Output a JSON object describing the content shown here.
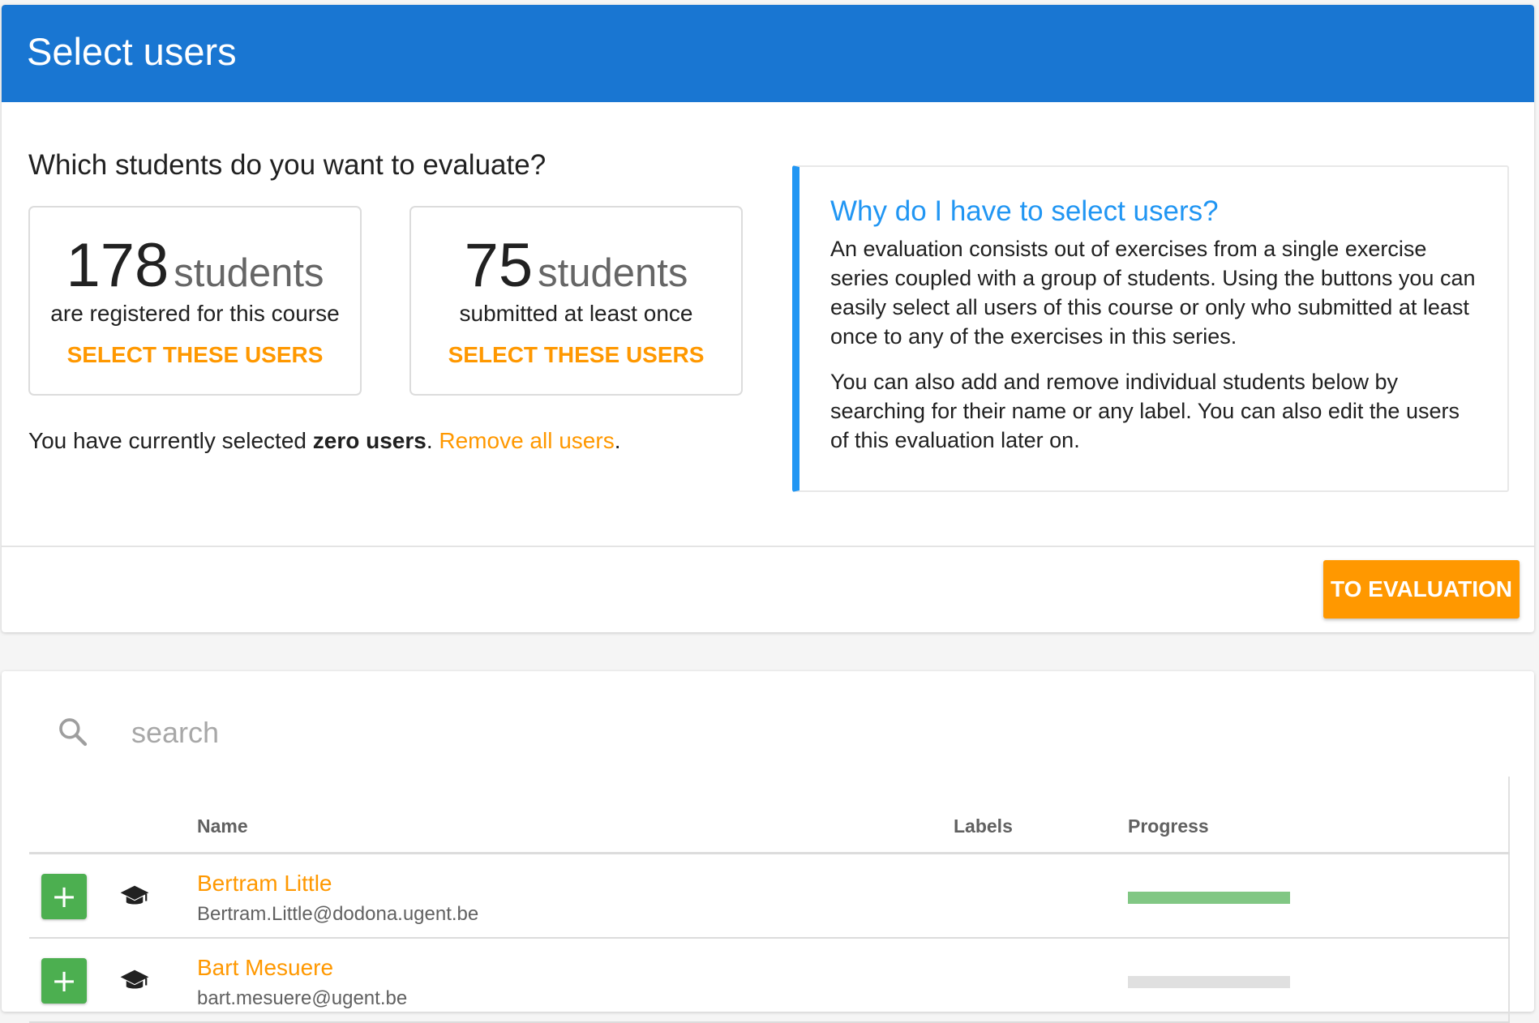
{
  "header": {
    "title": "Select users"
  },
  "intro": {
    "question": "Which students do you want to evaluate?"
  },
  "stats": [
    {
      "count": "178",
      "unit": "students",
      "description": "are registered for this course",
      "action": "SELECT THESE USERS"
    },
    {
      "count": "75",
      "unit": "students",
      "description": "submitted at least once",
      "action": "SELECT THESE USERS"
    }
  ],
  "selection": {
    "prefix": "You have currently selected ",
    "amount": "zero users",
    "separator": ". ",
    "remove_link": "Remove all users",
    "suffix": "."
  },
  "info": {
    "title": "Why do I have to select users?",
    "paragraphs": [
      "An evaluation consists out of exercises from a single exercise series coupled with a group of students. Using the buttons you can easily select all users of this course or only who submitted at least once to any of the exercises in this series.",
      "You can also add and remove individual students below by searching for their name or any label. You can also edit the users of this evaluation later on."
    ]
  },
  "actions": {
    "to_evaluation": "TO EVALUATION"
  },
  "search": {
    "placeholder": "search",
    "icon": "search-icon"
  },
  "table": {
    "columns": {
      "name": "Name",
      "labels": "Labels",
      "progress": "Progress"
    },
    "rows": [
      {
        "name": "Bertram Little",
        "email": "Bertram.Little@dodona.ugent.be",
        "add": "+",
        "icon": "graduation-cap-icon",
        "progress": 1.0,
        "progress_color": "#81c784"
      },
      {
        "name": "Bart Mesuere",
        "email": "bart.mesuere@ugent.be",
        "add": "+",
        "icon": "graduation-cap-icon",
        "progress": 0.0,
        "progress_color": "#e0e0e0"
      }
    ]
  },
  "colors": {
    "primary": "#1976d2",
    "accent": "#ff9800",
    "info": "#2196f3",
    "success": "#4caf50"
  }
}
